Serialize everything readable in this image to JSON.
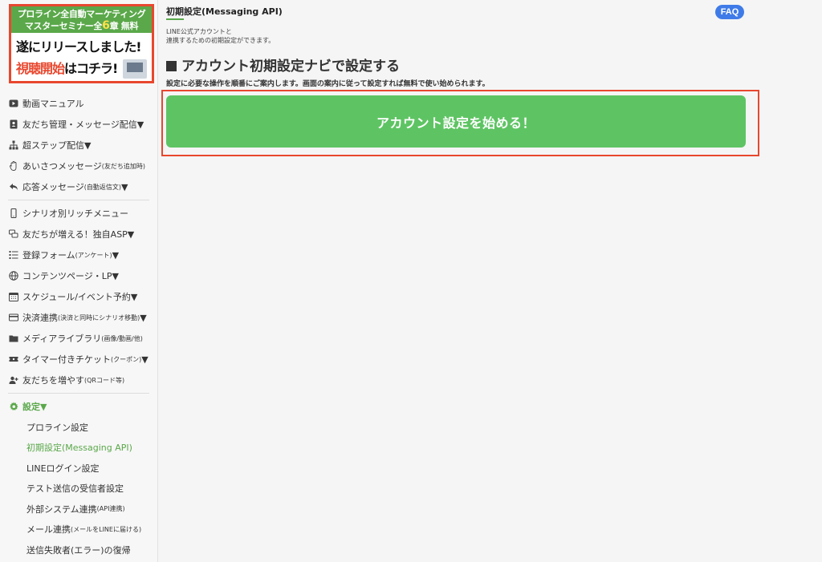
{
  "banner": {
    "top_line1": "プロライン全自動マーケティング",
    "top_line2_a": "マスターセミナー全",
    "top_line2_num": "6",
    "top_line2_b": "章 無料",
    "line1": "遂にリリースしました!",
    "line2_red": "視聴開始",
    "line2_rest": "はコチラ!"
  },
  "nav": {
    "items": [
      {
        "label": "動画マニュアル",
        "icon": "play-icon"
      },
      {
        "label": "友だち管理・メッセージ配信▼",
        "icon": "contact-book-icon"
      },
      {
        "label": "超ステップ配信▼",
        "icon": "sitemap-icon"
      },
      {
        "label": "あいさつメッセージ",
        "small": "(友だち追加時)",
        "icon": "hand-icon"
      },
      {
        "label": "応答メッセージ",
        "small": "(自動返信文)",
        "suffix": "▼",
        "icon": "reply-icon"
      },
      {
        "label": "シナリオ別リッチメニュー",
        "icon": "mobile-icon"
      },
      {
        "label": "友だちが増える！独自ASP▼",
        "icon": "chat-icon"
      },
      {
        "label": "登録フォーム",
        "small": "(アンケート)",
        "suffix": "▼",
        "icon": "list-icon"
      },
      {
        "label": "コンテンツページ・LP▼",
        "icon": "globe-icon"
      },
      {
        "label": "スケジュール/イベント予約▼",
        "icon": "calendar-icon"
      },
      {
        "label": "決済連携",
        "small": "(決済と同時にシナリオ移動)",
        "suffix": "▼",
        "icon": "credit-card-icon"
      },
      {
        "label": "メディアライブラリ",
        "small": "(画像/動画/他)",
        "icon": "folder-icon"
      },
      {
        "label": "タイマー付きチケット",
        "small": "(クーポン)",
        "suffix": "▼",
        "icon": "ticket-icon"
      },
      {
        "label": "友だちを増やす",
        "small": "(QRコード等)",
        "icon": "user-plus-icon"
      }
    ],
    "settings_label": "設定▼",
    "sub_items": [
      {
        "label": "プロライン設定"
      },
      {
        "label": "初期設定(Messaging API)"
      },
      {
        "label": "LINEログイン設定"
      },
      {
        "label": "テスト送信の受信者設定"
      },
      {
        "label": "外部システム連携",
        "small": "(API連携)"
      },
      {
        "label": "メール連携",
        "small": "(メールをLINEに届ける)"
      },
      {
        "label": "送信失敗者(エラー)の復帰"
      }
    ]
  },
  "main": {
    "page_title": "初期設定(Messaging API)",
    "desc_line1": "LINE公式アカウントと",
    "desc_line2": "連携するための初期設定ができます。",
    "faq_label": "FAQ",
    "section_heading": "アカウント初期設定ナビで設定する",
    "instruction": "設定に必要な操作を順番にご案内します。画面の案内に従って設定すれば無料で使い始められます。",
    "start_button": "アカウント設定を始める！"
  },
  "colors": {
    "accent_green": "#5aa84a",
    "button_green": "#5ec463",
    "highlight_red": "#e8472e",
    "faq_blue": "#3f7be8"
  }
}
